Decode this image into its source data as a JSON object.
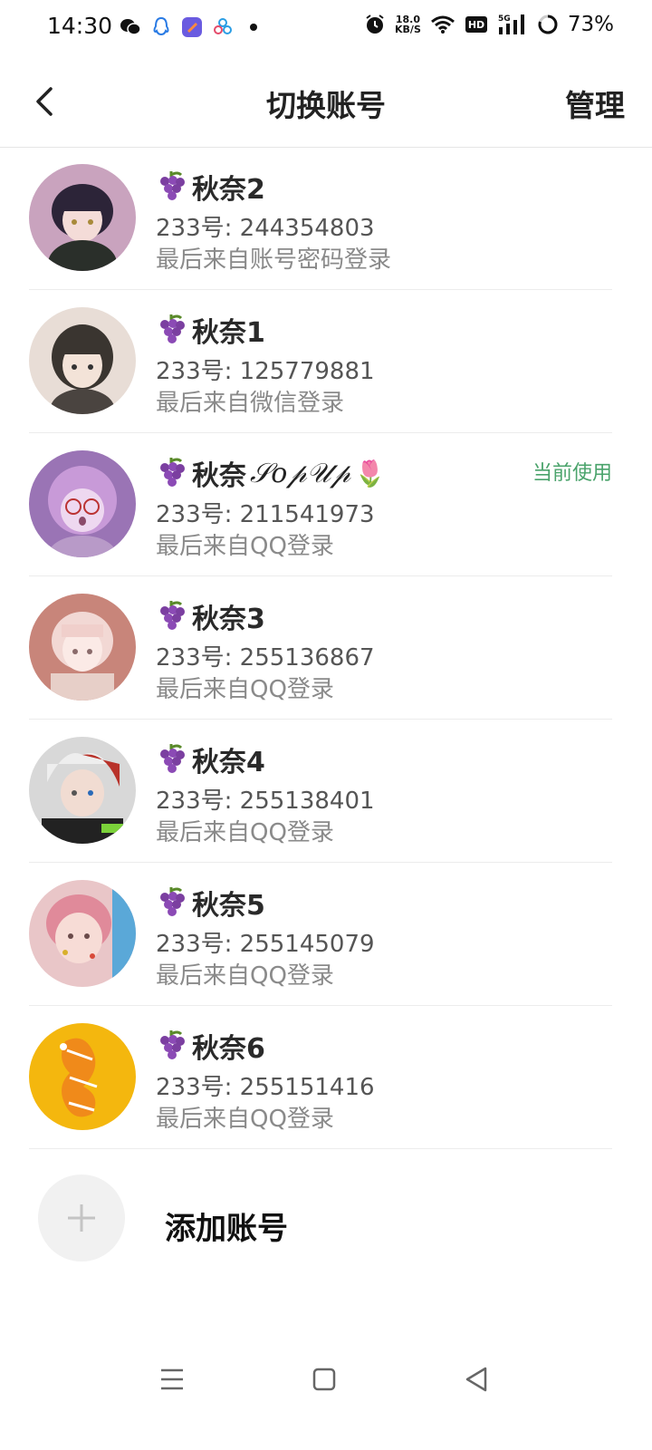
{
  "status_bar": {
    "time": "14:30",
    "network_speed": "18.0",
    "network_speed_unit": "KB/S",
    "hd_label": "HD",
    "signal_label": "5G",
    "battery": "73%",
    "app_icons": [
      "wechat-icon",
      "qq-icon",
      "app-icon",
      "clover-icon",
      "dot-icon"
    ]
  },
  "header": {
    "title": "切换账号",
    "manage": "管理"
  },
  "accounts": [
    {
      "name": "秋奈2",
      "account": "233号: 244354803",
      "source": "最后来自账号密码登录"
    },
    {
      "name": "秋奈1",
      "account": "233号: 125779881",
      "source": "最后来自微信登录"
    },
    {
      "name": "秋奈",
      "name_extra": "𝒮𝑜𝓅𝒰𝓅",
      "name_emoji": "🌷",
      "account": "233号: 211541973",
      "source": "最后来自QQ登录",
      "badge": "当前使用"
    },
    {
      "name": "秋奈3",
      "account": "233号: 255136867",
      "source": "最后来自QQ登录"
    },
    {
      "name": "秋奈4",
      "account": "233号: 255138401",
      "source": "最后来自QQ登录"
    },
    {
      "name": "秋奈5",
      "account": "233号: 255145079",
      "source": "最后来自QQ登录"
    },
    {
      "name": "秋奈6",
      "account": "233号: 255151416",
      "source": "最后来自QQ登录"
    }
  ],
  "add_account": {
    "label": "添加账号"
  },
  "colors": {
    "accent_green": "#4aa36b",
    "divider": "#ececec"
  }
}
